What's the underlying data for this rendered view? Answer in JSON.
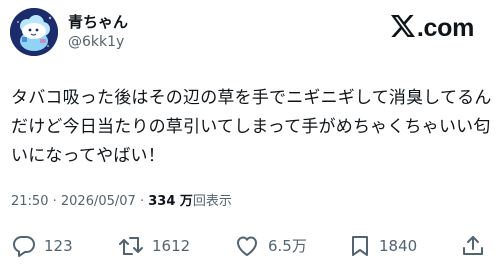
{
  "author": {
    "name": "青ちゃん",
    "handle": "@6kk1y"
  },
  "brand": {
    "logo_text": "X.com",
    "icon": "x-logo-icon"
  },
  "tweet": {
    "lines": [
      "タバコ吸った後はその辺の草を手でニギニギして消臭してるん",
      "だけど今日当たりの草引いてしまって手がめちゃくちゃいい匂",
      "いになってやばい！"
    ]
  },
  "meta": {
    "time": "21:50",
    "separator": "·",
    "date": "2026/05/07",
    "views_count": "334 万",
    "views_label": "回表示"
  },
  "actions": {
    "reply": {
      "icon": "reply-icon",
      "count": "123"
    },
    "retweet": {
      "icon": "retweet-icon",
      "count": "1612"
    },
    "like": {
      "icon": "heart-icon",
      "count": "6.5万"
    },
    "bookmark": {
      "icon": "bookmark-icon",
      "count": "1840"
    },
    "share": {
      "icon": "share-icon"
    }
  },
  "colors": {
    "text": "#0f1419",
    "secondary": "#536471",
    "avatar_bg": "#1c2b6b"
  }
}
